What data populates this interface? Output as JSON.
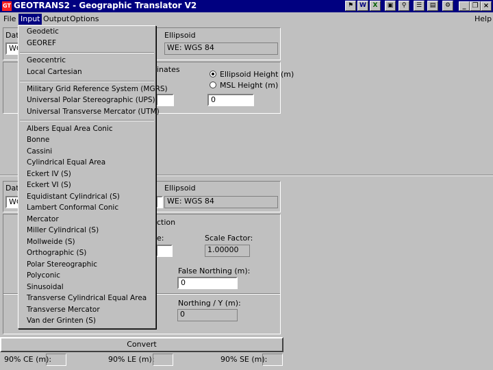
{
  "window": {
    "title": "GEOTRANS2 - Geographic Translator V2",
    "app_icon": "gt-app-icon"
  },
  "tray_icons": [
    "flag-icon",
    "word-icon",
    "excel-icon",
    "monitor-icon",
    "search-icon",
    "find-doc-icon",
    "chart-icon",
    "settings-icon"
  ],
  "menubar": {
    "file": "File",
    "input": "Input",
    "output": "Output",
    "options": "Options",
    "help": "Help"
  },
  "input_panel": {
    "datum_label": "Dat",
    "datum_value": "WG",
    "ellipsoid_label": "Ellipsoid",
    "ellipsoid_value": "WE: WGS 84",
    "coords_label": "inates",
    "height_options": [
      "Ellipsoid Height (m)",
      "MSL Height (m)"
    ],
    "height_value": "0"
  },
  "output_panel": {
    "datum_label": "Dat",
    "datum_value": "WG",
    "ellipsoid_label": "Ellipsoid",
    "ellipsoid_value": "WE: WGS 84",
    "projection_label": "ction",
    "param_label": "e:",
    "scale_factor_label": "Scale Factor:",
    "scale_factor_value": "1.00000",
    "false_northing_label": "False Northing (m):",
    "false_northing_value": "0",
    "northing_label": "Northing / Y (m):",
    "northing_value": "0"
  },
  "convert_label": "Convert",
  "errors": {
    "ce": "90% CE (m):",
    "le": "90% LE (m):",
    "se": "90% SE (m):"
  },
  "input_menu": {
    "group1": [
      "Geodetic",
      "GEOREF"
    ],
    "group2": [
      "Geocentric",
      "Local Cartesian"
    ],
    "group3": [
      "Military Grid Reference System (MGRS)",
      "Universal Polar Stereographic (UPS)",
      "Universal Transverse Mercator (UTM)"
    ],
    "group4": [
      "Albers Equal Area Conic",
      "Bonne",
      "Cassini",
      "Cylindrical Equal Area",
      "Eckert IV (S)",
      "Eckert VI (S)",
      "Equidistant Cylindrical (S)",
      "Lambert Conformal Conic",
      "Mercator",
      "Miller Cylindrical (S)",
      "Mollweide (S)",
      "Orthographic (S)",
      "Polar Stereographic",
      "Polyconic",
      "Sinusoidal",
      "Transverse Cylindrical Equal Area",
      "Transverse Mercator",
      "Van der Grinten (S)"
    ]
  }
}
